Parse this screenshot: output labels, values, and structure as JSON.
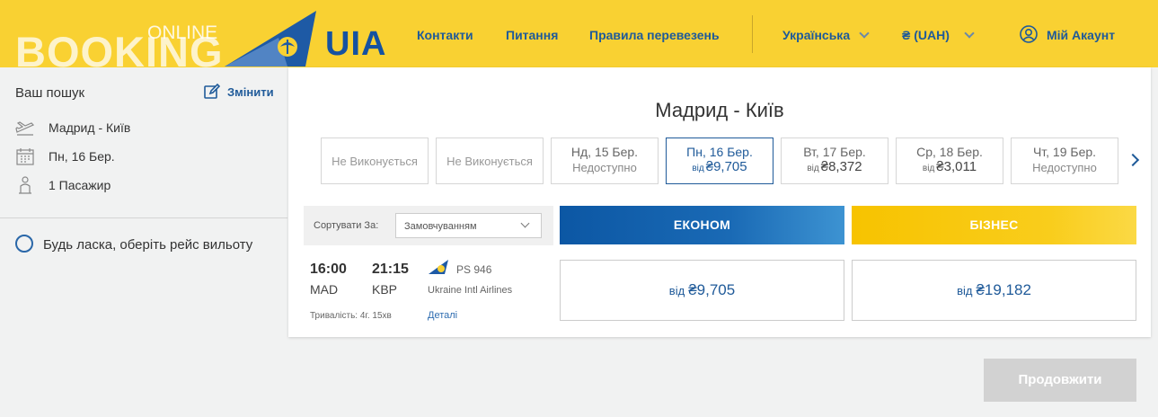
{
  "header": {
    "logo_main": "BOOKING",
    "logo_sub": "ONLINE",
    "brand": "UIA",
    "nav": [
      "Контакти",
      "Питання",
      "Правила перевезень"
    ],
    "language": "Українська",
    "currency": "₴ (UAH)",
    "account": "Мій Акаунт"
  },
  "sidebar": {
    "title": "Ваш пошук",
    "edit": "Змінити",
    "route": "Мадрид - Київ",
    "date": "Пн, 16 Бер.",
    "passengers": "1 Пасажир",
    "select_prompt": "Будь ласка, оберіть рейс вильоту"
  },
  "main": {
    "route_title": "Мадрид - Київ",
    "dates": [
      {
        "label": "",
        "status": "Не Виконується",
        "from": "",
        "price": ""
      },
      {
        "label": "",
        "status": "Не Виконується",
        "from": "",
        "price": ""
      },
      {
        "label": "Нд, 15 Бер.",
        "status": "Недоступно",
        "from": "",
        "price": ""
      },
      {
        "label": "Пн, 16 Бер.",
        "status": "",
        "from": "від",
        "price": "₴9,705"
      },
      {
        "label": "Вт, 17 Бер.",
        "status": "",
        "from": "від",
        "price": "₴8,372"
      },
      {
        "label": "Ср, 18 Бер.",
        "status": "",
        "from": "від",
        "price": "₴3,011"
      },
      {
        "label": "Чт, 19 Бер.",
        "status": "Недоступно",
        "from": "",
        "price": ""
      }
    ],
    "sort_label": "Сортувати За:",
    "sort_value": "Замовчуванням",
    "economy": "ЕКОНОМ",
    "business": "БІЗНЕС",
    "flight": {
      "dep_time": "16:00",
      "dep_code": "MAD",
      "arr_time": "21:15",
      "arr_code": "KBP",
      "number": "PS 946",
      "airline": "Ukraine Intl Airlines",
      "duration": "Тривалість: 4г. 15хв",
      "details": "Деталі",
      "economy_from": "від",
      "economy_price": "₴9,705",
      "business_from": "від",
      "business_price": "₴19,182"
    },
    "continue": "Продовжити"
  },
  "colors": {
    "header_bg": "#f9d132",
    "brand_blue": "#1f5a99",
    "economy_gradient": [
      "#0c57a4",
      "#3d93d2"
    ],
    "business_gradient": [
      "#f7c300",
      "#fbd945"
    ],
    "disabled_button": "#d2d2d2"
  },
  "icons": {
    "edit": "edit-icon",
    "route": "plane-icon",
    "date": "calendar-icon",
    "passengers": "passenger-icon",
    "account": "user-icon",
    "next": "chevron-right-icon"
  }
}
